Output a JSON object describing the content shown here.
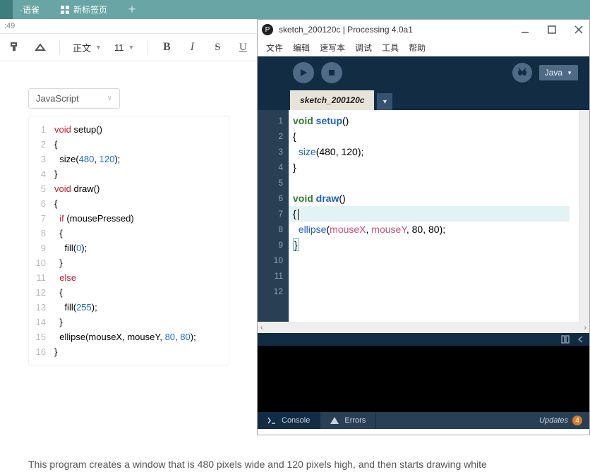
{
  "browser": {
    "tab1_suffix": "·语雀",
    "tab2": "新标签页",
    "time": ":49"
  },
  "toolbar": {
    "style_label": "正文",
    "size_label": "11",
    "bold": "B",
    "italic": "I",
    "strike": "S",
    "underline": "U"
  },
  "doc": {
    "lang": "JavaScript",
    "code_tokens": [
      [
        [
          "k-red",
          "void"
        ],
        [
          "",
          " setup()"
        ]
      ],
      [
        [
          "",
          "{"
        ]
      ],
      [
        [
          "",
          "  size("
        ],
        [
          "k-blue",
          "480"
        ],
        [
          "",
          ", "
        ],
        [
          "k-blue",
          "120"
        ],
        [
          "",
          ");"
        ]
      ],
      [
        [
          "",
          "}"
        ]
      ],
      [
        [
          "k-red",
          "void"
        ],
        [
          "",
          " draw()"
        ]
      ],
      [
        [
          "",
          "{"
        ]
      ],
      [
        [
          "",
          "  "
        ],
        [
          "k-red",
          "if"
        ],
        [
          "",
          " (mousePressed)"
        ]
      ],
      [
        [
          "",
          "  {"
        ]
      ],
      [
        [
          "",
          "    fill("
        ],
        [
          "k-blue",
          "0"
        ],
        [
          "",
          ");"
        ]
      ],
      [
        [
          "",
          "  }"
        ]
      ],
      [
        [
          "",
          "  "
        ],
        [
          "k-red",
          "else"
        ]
      ],
      [
        [
          "",
          "  {"
        ]
      ],
      [
        [
          "",
          "    fill("
        ],
        [
          "k-blue",
          "255"
        ],
        [
          "",
          ");"
        ]
      ],
      [
        [
          "",
          "  }"
        ]
      ],
      [
        [
          "",
          "  ellipse(mouseX, mouseY, "
        ],
        [
          "k-blue",
          "80"
        ],
        [
          "",
          ", "
        ],
        [
          "k-blue",
          "80"
        ],
        [
          "",
          ");"
        ]
      ],
      [
        [
          "",
          "}"
        ]
      ]
    ],
    "body": "This program creates a window that is 480 pixels wide and 120 pixels high, and then starts drawing white"
  },
  "proc": {
    "title": "sketch_200120c | Processing 4.0a1",
    "menu": [
      "文件",
      "编辑",
      "速写本",
      "调试",
      "工具",
      "帮助"
    ],
    "mode": "Java",
    "tab": "sketch_200120c",
    "gutter": [
      "1",
      "2",
      "3",
      "4",
      "5",
      "6",
      "7",
      "8",
      "9",
      "10",
      "11",
      "12"
    ],
    "code_rows": [
      [
        [
          "p-kw",
          "void"
        ],
        [
          "",
          " "
        ],
        [
          "p-fn",
          "setup"
        ],
        [
          "",
          "()"
        ]
      ],
      [
        [
          "",
          "{"
        ]
      ],
      [
        [
          "",
          "  "
        ],
        [
          "p-fn2",
          "size"
        ],
        [
          "",
          "(480, 120);"
        ]
      ],
      [
        [
          "",
          "}"
        ]
      ],
      [
        [
          "",
          ""
        ]
      ],
      [
        [
          "p-kw",
          "void"
        ],
        [
          "",
          " "
        ],
        [
          "p-fn",
          "draw"
        ],
        [
          "",
          "()"
        ]
      ],
      [
        [
          "",
          "{"
        ]
      ],
      [
        [
          "",
          "  "
        ],
        [
          "p-fn2",
          "ellipse"
        ],
        [
          "",
          "("
        ],
        [
          "p-var",
          "mouseX"
        ],
        [
          "",
          ", "
        ],
        [
          "p-var",
          "mouseY"
        ],
        [
          "",
          ", 80, 80);"
        ]
      ],
      [
        [
          "bracket-hl",
          "}"
        ]
      ]
    ],
    "highlight_row": 6,
    "console_tab": "Console",
    "errors_tab": "Errors",
    "updates": "Updates",
    "update_count": "4"
  },
  "chart_data": null
}
